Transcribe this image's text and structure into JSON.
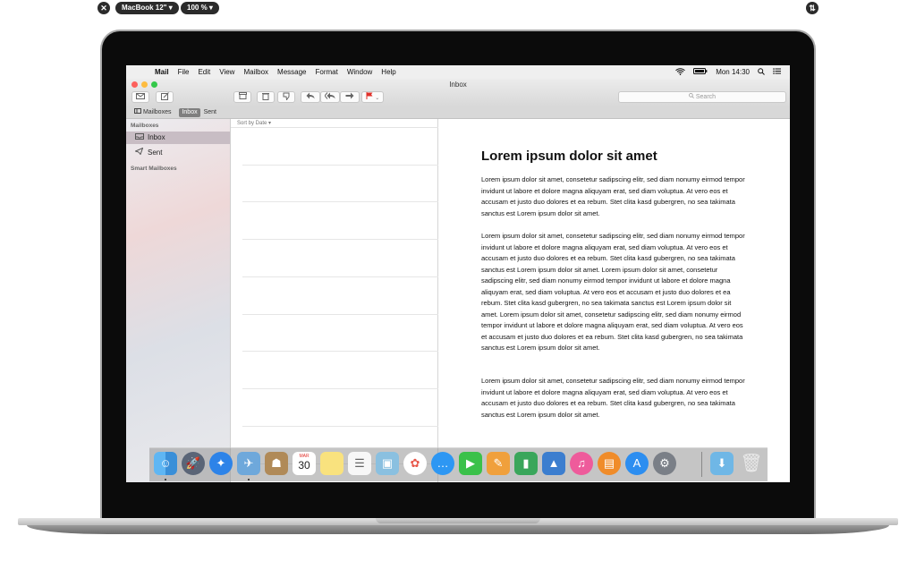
{
  "viewer": {
    "device_label": "MacBook 12\" ▾",
    "zoom_label": "100 % ▾"
  },
  "menubar": {
    "app": "Mail",
    "items": [
      "File",
      "Edit",
      "View",
      "Mailbox",
      "Message",
      "Format",
      "Window",
      "Help"
    ],
    "clock": "Mon 14:30"
  },
  "window": {
    "title": "Inbox",
    "search_placeholder": "Search"
  },
  "favorites": {
    "mailboxes": "Mailboxes",
    "inbox": "Inbox",
    "sent": "Sent"
  },
  "sidebar": {
    "header": "Mailboxes",
    "items": [
      {
        "label": "Inbox",
        "selected": true
      },
      {
        "label": "Sent",
        "selected": false
      }
    ],
    "smart_header": "Smart Mailboxes"
  },
  "message_list": {
    "sort_label": "Sort by Date ▾"
  },
  "message": {
    "heading": "Lorem ipsum dolor sit amet",
    "paragraphs": [
      "Lorem ipsum dolor sit amet, consetetur sadipscing elitr, sed diam nonumy eirmod tempor invidunt ut labore et dolore magna aliquyam erat, sed diam voluptua. At vero eos et accusam et justo duo dolores et ea rebum. Stet clita kasd gubergren, no sea takimata sanctus est Lorem ipsum dolor sit amet.",
      "Lorem ipsum dolor sit amet, consetetur sadipscing elitr, sed diam nonumy eirmod tempor invidunt ut labore et dolore magna aliquyam erat, sed diam voluptua. At vero eos et accusam et justo duo dolores et ea rebum. Stet clita kasd gubergren, no sea takimata sanctus est Lorem ipsum dolor sit amet. Lorem ipsum dolor sit amet, consetetur sadipscing elitr, sed diam nonumy eirmod tempor invidunt ut labore et dolore magna aliquyam erat, sed diam voluptua. At vero eos et accusam et justo duo dolores et ea rebum. Stet clita kasd gubergren, no sea takimata sanctus est Lorem ipsum dolor sit amet. Lorem ipsum dolor sit amet, consetetur sadipscing elitr, sed diam nonumy eirmod tempor invidunt ut labore et dolore magna aliquyam erat, sed diam voluptua. At vero eos et accusam et justo duo dolores et ea rebum. Stet clita kasd gubergren, no sea takimata sanctus est Lorem ipsum dolor sit amet.",
      "Lorem ipsum dolor sit amet, consetetur sadipscing elitr, sed diam nonumy eirmod tempor invidunt ut labore et dolore magna aliquyam erat, sed diam voluptua. At vero eos et accusam et justo duo dolores et ea rebum. Stet clita kasd gubergren, no sea takimata sanctus est Lorem ipsum dolor sit amet."
    ]
  },
  "dock": {
    "calendar_month": "MAR",
    "calendar_day": "30",
    "apps": [
      "finder-icon",
      "launchpad-icon",
      "safari-icon",
      "mail-icon",
      "contacts-icon",
      "calendar-icon",
      "notes-icon",
      "reminders-icon",
      "preview-icon",
      "photos-icon",
      "messages-icon",
      "facetime-icon",
      "pages-icon",
      "numbers-icon",
      "keynote-icon",
      "itunes-icon",
      "ibooks-icon",
      "app-store-icon",
      "system-preferences-icon",
      "downloads-folder-icon",
      "trash-icon"
    ]
  },
  "colors": {
    "selection": "#c8bdc4",
    "flag": "#e0302a",
    "close": "#fc605c",
    "minimize": "#fdbc40",
    "zoom": "#34c84a"
  }
}
